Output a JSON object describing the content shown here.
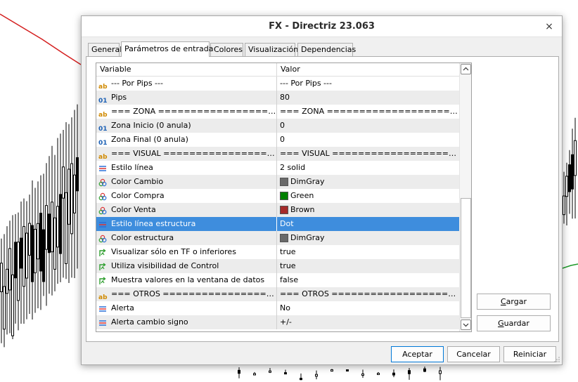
{
  "window": {
    "title": "FX - Directriz 23.063",
    "close_glyph": "×"
  },
  "tabs": [
    {
      "label": "General",
      "active": false
    },
    {
      "label": "Parámetros de entrada",
      "active": true
    },
    {
      "label": "Colores",
      "active": false
    },
    {
      "label": "Visualización",
      "active": false
    },
    {
      "label": "Dependencias",
      "active": false
    }
  ],
  "grid": {
    "col_variable": "Variable",
    "col_value": "Valor",
    "rows": [
      {
        "icon": "text-type-icon",
        "variable": "--- Por Pips ---",
        "value": "--- Por Pips ---"
      },
      {
        "icon": "number-type-icon",
        "variable": "Pips",
        "value": "80"
      },
      {
        "icon": "text-type-icon",
        "variable": "=== ZONA =============================",
        "value": "=== ZONA ============================="
      },
      {
        "icon": "number-type-icon",
        "variable": "Zona Inicio (0 anula)",
        "value": "0"
      },
      {
        "icon": "number-type-icon",
        "variable": "Zona Final (0 anula)",
        "value": "0"
      },
      {
        "icon": "text-type-icon",
        "variable": "=== VISUAL =============================",
        "value": "=== VISUAL ============================="
      },
      {
        "icon": "line-style-icon",
        "variable": "Estilo línea",
        "value": "2 solid"
      },
      {
        "icon": "color-type-icon",
        "variable": "Color Cambio",
        "value": "DimGray",
        "swatch": "#696969"
      },
      {
        "icon": "color-type-icon",
        "variable": "Color Compra",
        "value": "Green",
        "swatch": "#008000"
      },
      {
        "icon": "color-type-icon",
        "variable": "Color Venta",
        "value": "Brown",
        "swatch": "#a52a2a"
      },
      {
        "icon": "line-style-icon",
        "variable": "Estilo línea estructura",
        "value": "Dot",
        "selected": true
      },
      {
        "icon": "color-type-icon",
        "variable": "Color estructura",
        "value": "DimGray",
        "swatch": "#696969"
      },
      {
        "icon": "bool-type-icon",
        "variable": "Visualizar sólo en TF o inferiores",
        "value": "true"
      },
      {
        "icon": "bool-type-icon",
        "variable": "Utiliza visibilidad de Control",
        "value": "true"
      },
      {
        "icon": "bool-type-icon",
        "variable": "Muestra valores en la ventana de datos",
        "value": "false"
      },
      {
        "icon": "text-type-icon",
        "variable": "=== OTROS =============================",
        "value": "=== OTROS ============================="
      },
      {
        "icon": "line-style-icon",
        "variable": "Alerta",
        "value": "No"
      },
      {
        "icon": "line-style-icon",
        "variable": "Alerta cambio signo",
        "value": "+/-"
      }
    ]
  },
  "buttons": {
    "load": {
      "prefix": "",
      "accel": "C",
      "rest": "argar"
    },
    "save": {
      "prefix": "",
      "accel": "G",
      "rest": "uardar"
    },
    "ok": "Aceptar",
    "cancel": "Cancelar",
    "reset": "Reiniciar"
  },
  "colors": {
    "selection": "#3e8ddd",
    "text_icon": "#d08a00",
    "number_icon": "#1a5fb4",
    "bool_icon": "#2e9e2e",
    "primary_border": "#0078d7"
  }
}
